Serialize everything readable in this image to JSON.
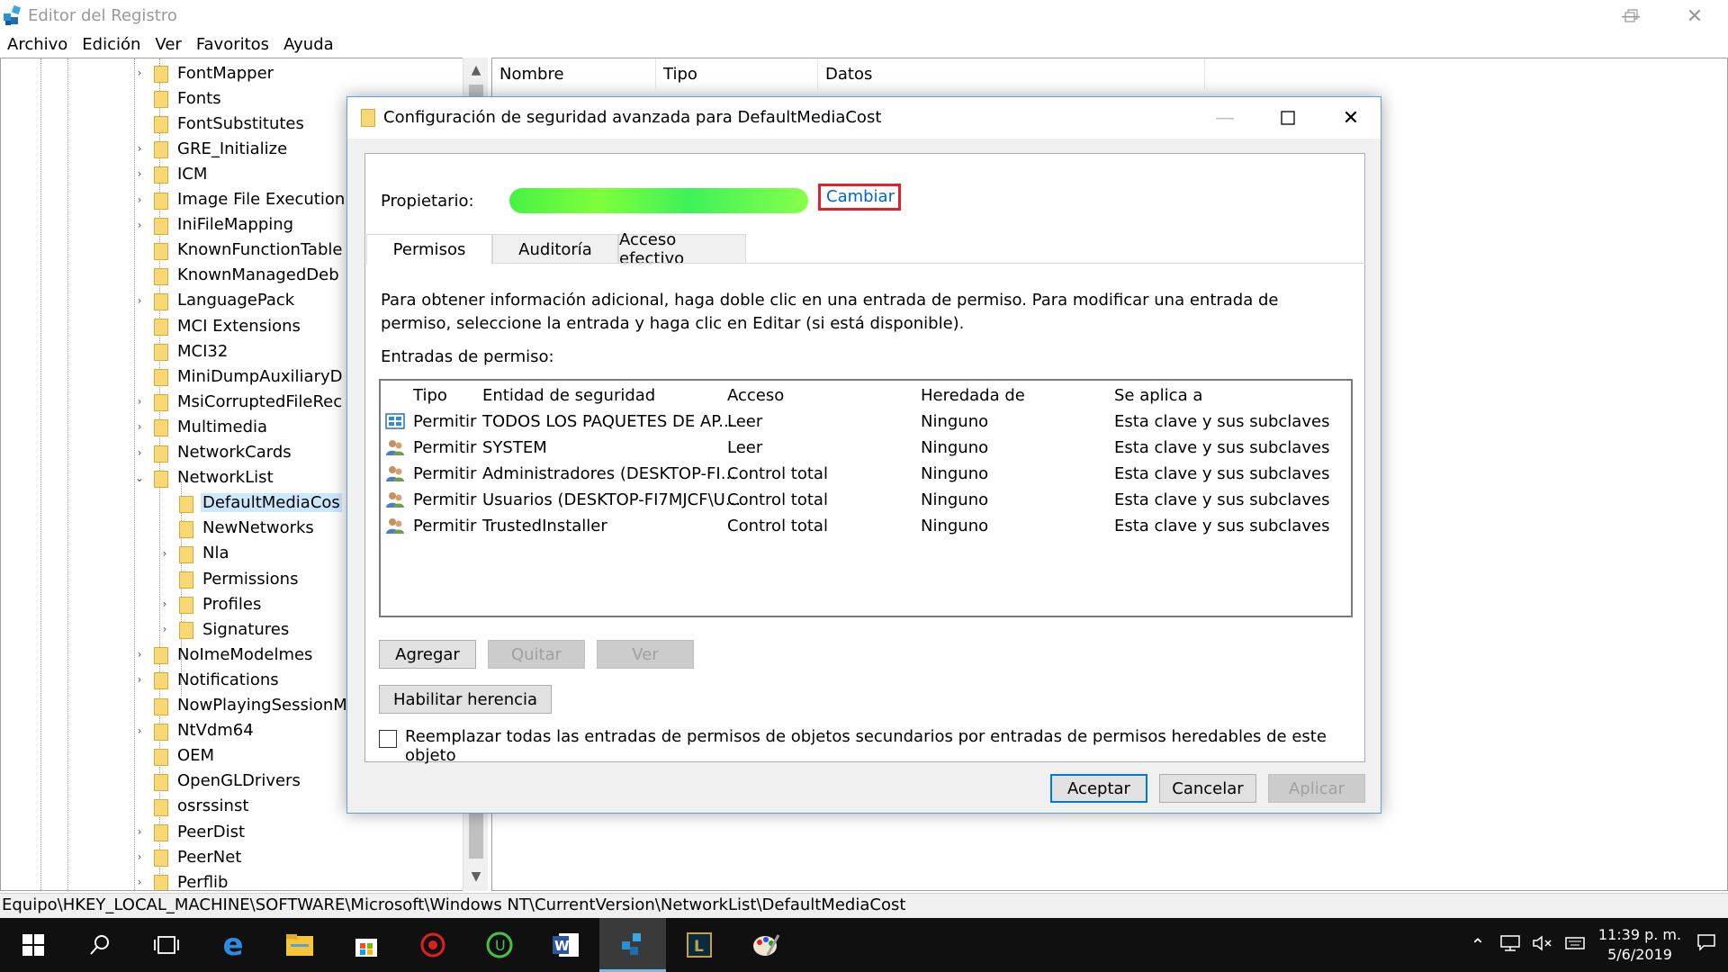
{
  "registry": {
    "title": "Editor del Registro",
    "menu": [
      "Archivo",
      "Edición",
      "Ver",
      "Favoritos",
      "Ayuda"
    ],
    "tree": [
      {
        "label": "FontMapper",
        "expander": "›",
        "level": 1
      },
      {
        "label": "Fonts",
        "expander": "",
        "level": 1
      },
      {
        "label": "FontSubstitutes",
        "expander": "",
        "level": 1
      },
      {
        "label": "GRE_Initialize",
        "expander": "›",
        "level": 1
      },
      {
        "label": "ICM",
        "expander": "›",
        "level": 1
      },
      {
        "label": "Image File Execution",
        "expander": "›",
        "level": 1
      },
      {
        "label": "IniFileMapping",
        "expander": "›",
        "level": 1
      },
      {
        "label": "KnownFunctionTable",
        "expander": "",
        "level": 1
      },
      {
        "label": "KnownManagedDeb",
        "expander": "",
        "level": 1
      },
      {
        "label": "LanguagePack",
        "expander": "›",
        "level": 1
      },
      {
        "label": "MCI Extensions",
        "expander": "",
        "level": 1
      },
      {
        "label": "MCI32",
        "expander": "",
        "level": 1
      },
      {
        "label": "MiniDumpAuxiliaryD",
        "expander": "",
        "level": 1
      },
      {
        "label": "MsiCorruptedFileRec",
        "expander": "›",
        "level": 1
      },
      {
        "label": "Multimedia",
        "expander": "›",
        "level": 1
      },
      {
        "label": "NetworkCards",
        "expander": "›",
        "level": 1
      },
      {
        "label": "NetworkList",
        "expander": "⌄",
        "level": 1
      },
      {
        "label": "DefaultMediaCos",
        "expander": "",
        "level": 2,
        "selected": true
      },
      {
        "label": "NewNetworks",
        "expander": "",
        "level": 2
      },
      {
        "label": "Nla",
        "expander": "›",
        "level": 2
      },
      {
        "label": "Permissions",
        "expander": "",
        "level": 2
      },
      {
        "label": "Profiles",
        "expander": "›",
        "level": 2
      },
      {
        "label": "Signatures",
        "expander": "›",
        "level": 2
      },
      {
        "label": "NoImeModelmes",
        "expander": "›",
        "level": 1
      },
      {
        "label": "Notifications",
        "expander": "›",
        "level": 1
      },
      {
        "label": "NowPlayingSessionM",
        "expander": "",
        "level": 1
      },
      {
        "label": "NtVdm64",
        "expander": "›",
        "level": 1
      },
      {
        "label": "OEM",
        "expander": "",
        "level": 1
      },
      {
        "label": "OpenGLDrivers",
        "expander": "",
        "level": 1
      },
      {
        "label": "osrssinst",
        "expander": "",
        "level": 1
      },
      {
        "label": "PeerDist",
        "expander": "›",
        "level": 1
      },
      {
        "label": "PeerNet",
        "expander": "›",
        "level": 1
      },
      {
        "label": "Perflib",
        "expander": "›",
        "level": 1
      }
    ],
    "list_headers": [
      "Nombre",
      "Tipo",
      "Datos"
    ],
    "status_path": "Equipo\\HKEY_LOCAL_MACHINE\\SOFTWARE\\Microsoft\\Windows NT\\CurrentVersion\\NetworkList\\DefaultMediaCost"
  },
  "dialog": {
    "title": "Configuración de seguridad avanzada para DefaultMediaCost",
    "owner_label": "Propietario:",
    "change_link": "Cambiar",
    "tabs": [
      "Permisos",
      "Auditoría",
      "Acceso efectivo"
    ],
    "info_text": "Para obtener información adicional, haga doble clic en una entrada de permiso. Para modificar una entrada de permiso, seleccione la entrada y haga clic en Editar (si está disponible).",
    "entries_label": "Entradas de permiso:",
    "columns": [
      "Tipo",
      "Entidad de seguridad",
      "Acceso",
      "Heredada de",
      "Se aplica a"
    ],
    "entries": [
      {
        "icon": "packages-icon",
        "type": "Permitir",
        "principal": "TODOS LOS PAQUETES DE AP...",
        "access": "Leer",
        "inherited": "Ninguno",
        "applies": "Esta clave y sus subclaves"
      },
      {
        "icon": "users-icon",
        "type": "Permitir",
        "principal": "SYSTEM",
        "access": "Leer",
        "inherited": "Ninguno",
        "applies": "Esta clave y sus subclaves"
      },
      {
        "icon": "users-icon",
        "type": "Permitir",
        "principal": "Administradores (DESKTOP-FI...",
        "access": "Control total",
        "inherited": "Ninguno",
        "applies": "Esta clave y sus subclaves"
      },
      {
        "icon": "users-icon",
        "type": "Permitir",
        "principal": "Usuarios (DESKTOP-FI7MJCF\\U...",
        "access": "Control total",
        "inherited": "Ninguno",
        "applies": "Esta clave y sus subclaves"
      },
      {
        "icon": "users-icon",
        "type": "Permitir",
        "principal": "TrustedInstaller",
        "access": "Control total",
        "inherited": "Ninguno",
        "applies": "Esta clave y sus subclaves"
      }
    ],
    "buttons": {
      "add": "Agregar",
      "remove": "Quitar",
      "view": "Ver",
      "enable_inheritance": "Habilitar herencia",
      "ok": "Aceptar",
      "cancel": "Cancelar",
      "apply": "Aplicar"
    },
    "replace_checkbox": "Reemplazar todas las entradas de permisos de objetos secundarios por entradas de permisos heredables de este objeto"
  },
  "taskbar": {
    "time": "11:39 p. m.",
    "date": "5/6/2019"
  }
}
